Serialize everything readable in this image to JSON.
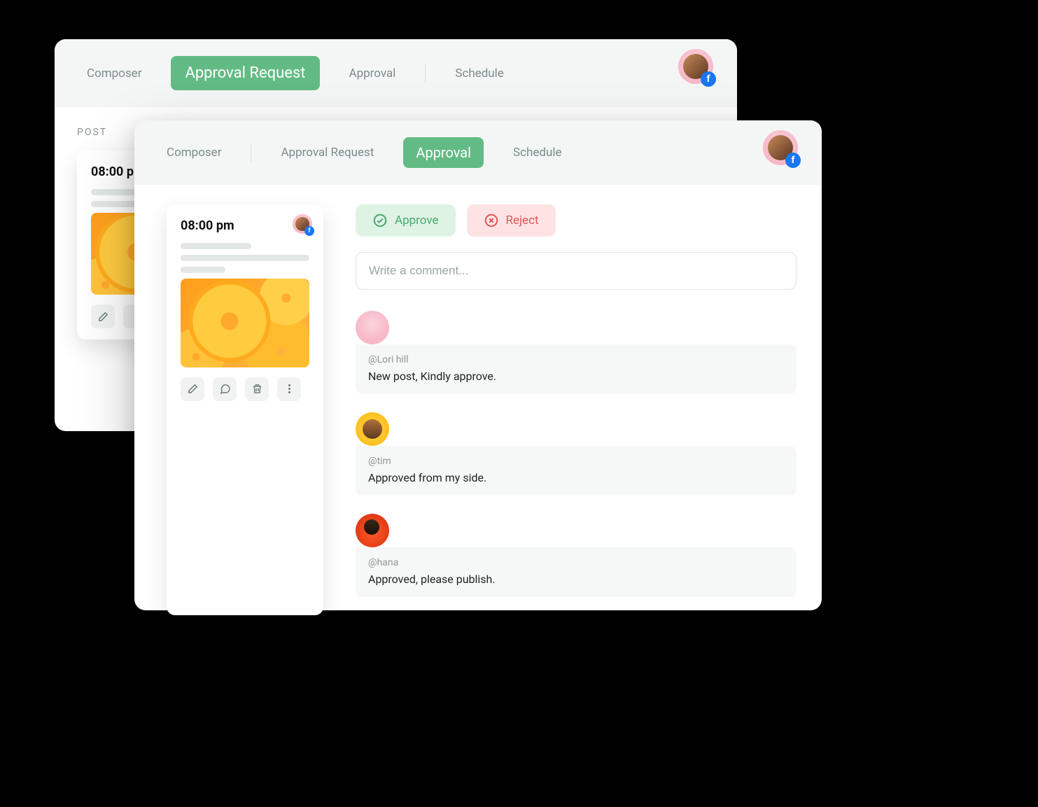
{
  "colors": {
    "accent": "#62bb84",
    "approve": "#46a96a",
    "reject": "#e25757",
    "facebook": "#1877f2"
  },
  "back_panel": {
    "tabs": {
      "composer": "Composer",
      "approval_request": "Approval Request",
      "approval": "Approval",
      "schedule": "Schedule",
      "active": "approval_request"
    },
    "section_label": "POST",
    "post": {
      "time": "08:00 pm"
    }
  },
  "front_panel": {
    "tabs": {
      "composer": "Composer",
      "approval_request": "Approval Request",
      "approval": "Approval",
      "schedule": "Schedule",
      "active": "approval"
    },
    "post": {
      "time": "08:00 pm"
    },
    "actions": {
      "approve": "Approve",
      "reject": "Reject"
    },
    "comment_input": {
      "placeholder": "Write a comment..."
    },
    "comments": [
      {
        "handle": "@Lori hill",
        "text": "New post, Kindly approve."
      },
      {
        "handle": "@tim",
        "text": "Approved from my side."
      },
      {
        "handle": "@hana",
        "text": "Approved, please publish."
      }
    ]
  },
  "icons": {
    "edit": "edit-icon",
    "comment": "comment-icon",
    "delete": "trash-icon",
    "more": "more-icon",
    "facebook": "facebook-icon",
    "approve": "check-circle-icon",
    "reject": "x-circle-icon"
  }
}
